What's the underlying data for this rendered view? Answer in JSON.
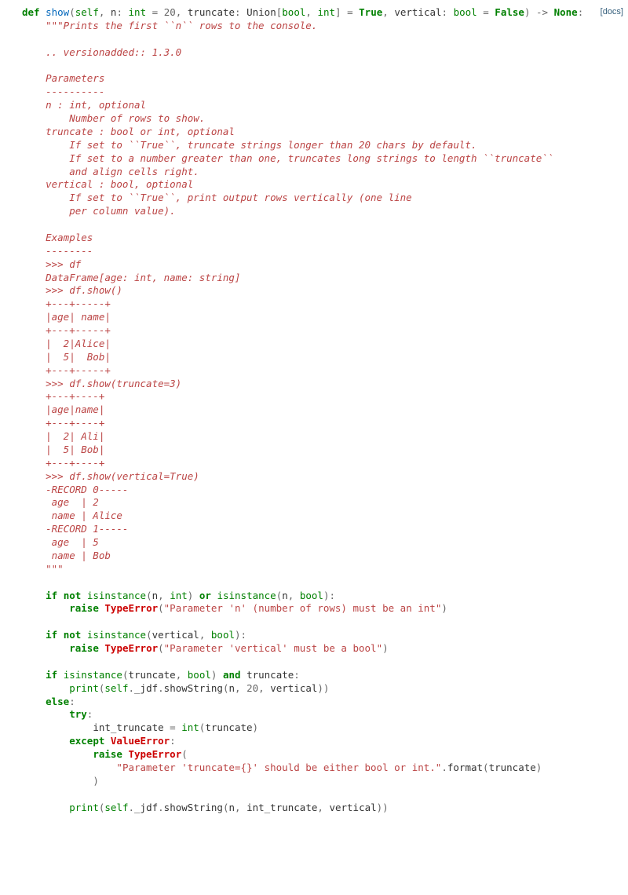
{
  "docs_link": "[docs]",
  "sig": {
    "def": "def",
    "name": "show",
    "self": "self",
    "n_name": "n",
    "int": "int",
    "n_default": "20",
    "truncate_name": "truncate",
    "union": "Union",
    "bool": "bool",
    "truncate_default": "True",
    "vertical_name": "vertical",
    "vertical_default": "False",
    "arrow": "->",
    "none": "None"
  },
  "docstring": "\"\"\"Prints the first ``n`` rows to the console.\n\n.. versionadded:: 1.3.0\n\nParameters\n----------\nn : int, optional\n    Number of rows to show.\ntruncate : bool or int, optional\n    If set to ``True``, truncate strings longer than 20 chars by default.\n    If set to a number greater than one, truncates long strings to length ``truncate``\n    and align cells right.\nvertical : bool, optional\n    If set to ``True``, print output rows vertically (one line\n    per column value).\n\nExamples\n--------\n>>> df\nDataFrame[age: int, name: string]\n>>> df.show()\n+---+-----+\n|age| name|\n+---+-----+\n|  2|Alice|\n|  5|  Bob|\n+---+-----+\n>>> df.show(truncate=3)\n+---+----+\n|age|name|\n+---+----+\n|  2| Ali|\n|  5| Bob|\n+---+----+\n>>> df.show(vertical=True)\n-RECORD 0-----\n age  | 2\n name | Alice\n-RECORD 1-----\n age  | 5\n name | Bob\n\"\"\"",
  "body": {
    "if": "if",
    "not": "not",
    "or": "or",
    "and": "and",
    "else": "else",
    "try": "try",
    "except": "except",
    "raise": "raise",
    "isinstance": "isinstance",
    "print": "print",
    "TypeError": "TypeError",
    "ValueError": "ValueError",
    "err_n": "\"Parameter 'n' (number of rows) must be an int\"",
    "err_vertical": "\"Parameter 'vertical' must be a bool\"",
    "err_truncate": "\"Parameter 'truncate={}' should be either bool or int.\"",
    "format": "format",
    "jdf": "_jdf",
    "showString": "showString",
    "twenty": "20",
    "int_truncate": "int_truncate",
    "truncate": "truncate",
    "vertical": "vertical",
    "n": "n",
    "self": "self",
    "int": "int",
    "bool": "bool"
  }
}
